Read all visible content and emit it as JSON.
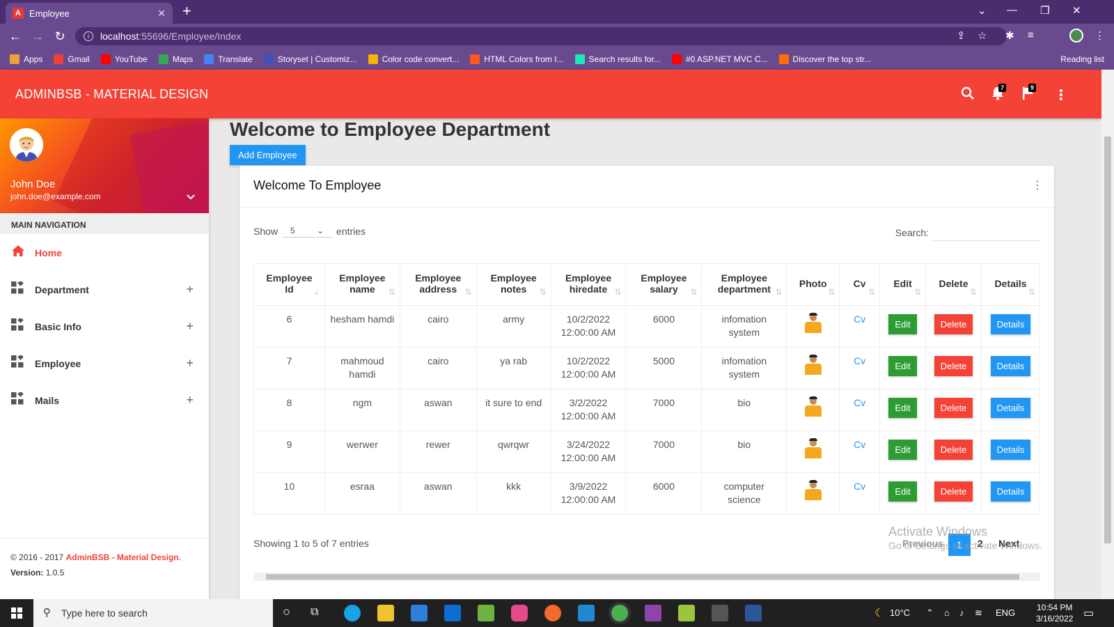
{
  "browser": {
    "tab_title": "Employee",
    "tab_favicon": "A",
    "url_host": "localhost",
    "url_path": ":55696/Employee/Index",
    "bookmarks": [
      {
        "label": "Apps",
        "color": "#e8a33a"
      },
      {
        "label": "Gmail",
        "color": "#ea4335"
      },
      {
        "label": "YouTube",
        "color": "#ff0000"
      },
      {
        "label": "Maps",
        "color": "#34a853"
      },
      {
        "label": "Translate",
        "color": "#4285f4"
      },
      {
        "label": "Storyset | Customiz...",
        "color": "#3f51b5"
      },
      {
        "label": "Color code convert...",
        "color": "#f4b400"
      },
      {
        "label": "HTML Colors from I...",
        "color": "#ff5722"
      },
      {
        "label": "Search results for...",
        "color": "#1de9b6"
      },
      {
        "label": "#0 ASP.NET MVC C...",
        "color": "#ff0000"
      },
      {
        "label": "Discover the top str...",
        "color": "#ff6f00"
      }
    ],
    "reading_list": "Reading list"
  },
  "header": {
    "brand": "ADMINBSB - MATERIAL DESIGN",
    "notifications_count": "7",
    "tasks_count": "9",
    "accent": "#f44336"
  },
  "sidebar": {
    "user_name": "John Doe",
    "user_email": "john.doe@example.com",
    "nav_heading": "MAIN NAVIGATION",
    "items": [
      {
        "label": "Home",
        "icon": "home-icon",
        "active": true
      },
      {
        "label": "Department",
        "icon": "widgets-icon"
      },
      {
        "label": "Basic Info",
        "icon": "widgets-icon"
      },
      {
        "label": "Employee",
        "icon": "widgets-icon"
      },
      {
        "label": "Mails",
        "icon": "widgets-icon"
      }
    ],
    "footer_copy": "© 2016 - 2017 ",
    "footer_brand": "AdminBSB - Material Design",
    "footer_dot": ".",
    "version_label": "Version:",
    "version": "1.0.5"
  },
  "main": {
    "page_title": "Welcome to Employee Department",
    "add_button": "Add Employee",
    "card_title": "Welcome To Employee",
    "show_label": "Show",
    "entries_value": "5",
    "entries_label": "entries",
    "search_label": "Search:",
    "columns": [
      [
        "Employee",
        "Id"
      ],
      [
        "Employee",
        "name"
      ],
      [
        "Employee",
        "address"
      ],
      [
        "Employee",
        "notes"
      ],
      [
        "Employee",
        "hiredate"
      ],
      [
        "Employee",
        "salary"
      ],
      [
        "Employee",
        "department"
      ],
      [
        "Photo",
        ""
      ],
      [
        "Cv",
        ""
      ],
      [
        "Edit",
        ""
      ],
      [
        "Delete",
        ""
      ],
      [
        "Details",
        ""
      ]
    ],
    "rows": [
      {
        "id": "6",
        "name": "hesham hamdi",
        "address": "cairo",
        "notes": "army",
        "hiredate": "10/2/2022 12:00:00 AM",
        "salary": "6000",
        "department": "infomation system"
      },
      {
        "id": "7",
        "name": "mahmoud hamdi",
        "address": "cairo",
        "notes": "ya rab",
        "hiredate": "10/2/2022 12:00:00 AM",
        "salary": "5000",
        "department": "infomation system"
      },
      {
        "id": "8",
        "name": "ngm",
        "address": "aswan",
        "notes": "it sure to end",
        "hiredate": "3/2/2022 12:00:00 AM",
        "salary": "7000",
        "department": "bio"
      },
      {
        "id": "9",
        "name": "werwer",
        "address": "rewer",
        "notes": "qwrqwr",
        "hiredate": "3/24/2022 12:00:00 AM",
        "salary": "7000",
        "department": "bio"
      },
      {
        "id": "10",
        "name": "esraa",
        "address": "aswan",
        "notes": "kkk",
        "hiredate": "3/9/2022 12:00:00 AM",
        "salary": "6000",
        "department": "computer science"
      }
    ],
    "cv_label": "Cv",
    "edit_label": "Edit",
    "delete_label": "Delete",
    "details_label": "Details",
    "showing_text": "Showing 1 to 5 of 7 entries",
    "pager": {
      "previous": "Previous",
      "page1": "1",
      "page2": "2",
      "next": "Next"
    },
    "watermark_line1": "Activate Windows",
    "watermark_line2": "Go to Settings to activate Windows."
  },
  "taskbar": {
    "search_placeholder": "Type here to search",
    "weather": "10°C",
    "language": "ENG",
    "time": "10:54 PM",
    "date": "3/16/2022"
  }
}
